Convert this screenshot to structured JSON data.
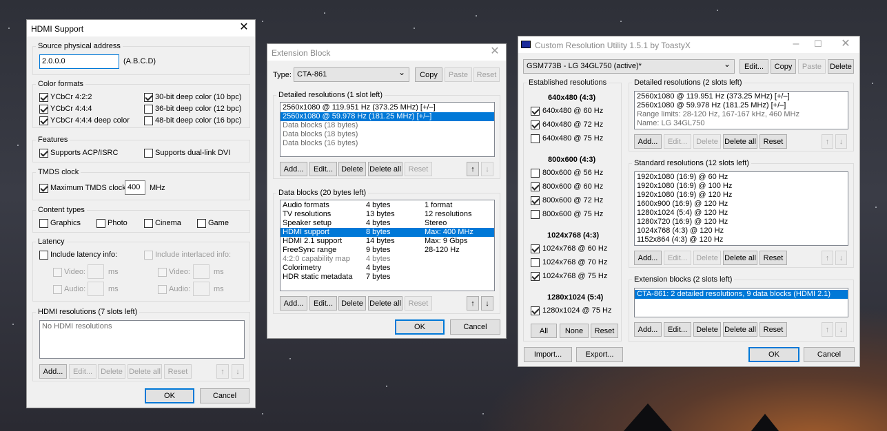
{
  "hdmi": {
    "title": "HDMI Support",
    "source_group": "Source physical address",
    "address": "2.0.0.0",
    "address_hint": "(A.B.C.D)",
    "color_group": "Color formats",
    "ycbcr422": "YCbCr 4:2:2",
    "ycbcr444": "YCbCr 4:4:4",
    "ycbcr444deep": "YCbCr 4:4:4 deep color",
    "deep30": "30-bit deep color (10 bpc)",
    "deep36": "36-bit deep color (12 bpc)",
    "deep48": "48-bit deep color (16 bpc)",
    "features_group": "Features",
    "acp": "Supports ACP/ISRC",
    "dual_dvi": "Supports dual-link DVI",
    "tmds_group": "TMDS clock",
    "tmds_label": "Maximum TMDS clock:",
    "tmds_value": "400",
    "tmds_unit": "MHz",
    "content_group": "Content types",
    "graphics": "Graphics",
    "photo": "Photo",
    "cinema": "Cinema",
    "game": "Game",
    "latency_group": "Latency",
    "include_latency": "Include latency info:",
    "include_interlaced": "Include interlaced info:",
    "video": "Video:",
    "audio": "Audio:",
    "ms": "ms",
    "res_group": "HDMI resolutions (7 slots left)",
    "res_empty": "No HDMI resolutions",
    "add": "Add...",
    "edit": "Edit...",
    "delete": "Delete",
    "delete_all": "Delete all",
    "reset": "Reset",
    "up": "↑",
    "down": "↓",
    "ok": "OK",
    "cancel": "Cancel"
  },
  "ext": {
    "title": "Extension Block",
    "type_label": "Type:",
    "type_value": "CTA-861",
    "copy": "Copy",
    "paste": "Paste",
    "reset": "Reset",
    "detailed_group": "Detailed resolutions (1 slot left)",
    "detailed": [
      {
        "text": "2560x1080 @ 119.951 Hz (373.25 MHz) [+/–]",
        "state": "normal"
      },
      {
        "text": "2560x1080 @ 59.978 Hz (181.25 MHz) [+/–]",
        "state": "sel"
      },
      {
        "text": "Data blocks (18 bytes)",
        "state": "gray"
      },
      {
        "text": "Data blocks (18 bytes)",
        "state": "gray"
      },
      {
        "text": "Data blocks (16 bytes)",
        "state": "gray"
      }
    ],
    "data_group": "Data blocks (20 bytes left)",
    "data_blocks": [
      {
        "name": "Audio formats",
        "size": "4 bytes",
        "info": "1 format",
        "state": "normal"
      },
      {
        "name": "TV resolutions",
        "size": "13 bytes",
        "info": "12 resolutions",
        "state": "normal"
      },
      {
        "name": "Speaker setup",
        "size": "4 bytes",
        "info": "Stereo",
        "state": "normal"
      },
      {
        "name": "HDMI support",
        "size": "8 bytes",
        "info": "Max: 400 MHz",
        "state": "sel"
      },
      {
        "name": "HDMI 2.1 support",
        "size": "14 bytes",
        "info": "Max: 9 Gbps",
        "state": "normal"
      },
      {
        "name": "FreeSync range",
        "size": "9 bytes",
        "info": "28-120 Hz",
        "state": "normal"
      },
      {
        "name": "4:2:0 capability map",
        "size": "4 bytes",
        "info": "",
        "state": "dis"
      },
      {
        "name": "Colorimetry",
        "size": "4 bytes",
        "info": "",
        "state": "normal"
      },
      {
        "name": "HDR static metadata",
        "size": "7 bytes",
        "info": "",
        "state": "normal"
      }
    ],
    "add": "Add...",
    "edit": "Edit...",
    "delete": "Delete",
    "delete_all": "Delete all",
    "reset_btn": "Reset",
    "up": "↑",
    "down": "↓",
    "ok": "OK",
    "cancel": "Cancel"
  },
  "cru": {
    "title": "Custom Resolution Utility 1.5.1 by ToastyX",
    "monitor": "GSM773B - LG 34GL750 (active)*",
    "edit": "Edit...",
    "copy": "Copy",
    "paste": "Paste",
    "delete": "Delete",
    "established_group": "Established resolutions",
    "h640": "640x480 (4:3)",
    "r640_60": "640x480 @ 60 Hz",
    "r640_72": "640x480 @ 72 Hz",
    "r640_75": "640x480 @ 75 Hz",
    "h800": "800x600 (4:3)",
    "r800_56": "800x600 @ 56 Hz",
    "r800_60": "800x600 @ 60 Hz",
    "r800_72": "800x600 @ 72 Hz",
    "r800_75": "800x600 @ 75 Hz",
    "h1024": "1024x768 (4:3)",
    "r1024_60": "1024x768 @ 60 Hz",
    "r1024_70": "1024x768 @ 70 Hz",
    "r1024_75": "1024x768 @ 75 Hz",
    "h1280": "1280x1024 (5:4)",
    "r1280_75": "1280x1024 @ 75 Hz",
    "all": "All",
    "none": "None",
    "reset": "Reset",
    "detailed_group": "Detailed resolutions (2 slots left)",
    "detailed": [
      {
        "text": "2560x1080 @ 119.951 Hz (373.25 MHz) [+/–]",
        "state": "normal"
      },
      {
        "text": "2560x1080 @ 59.978 Hz (181.25 MHz) [+/–]",
        "state": "normal"
      },
      {
        "text": "Range limits: 28-120 Hz, 167-167 kHz, 460 MHz",
        "state": "gray"
      },
      {
        "text": "Name: LG 34GL750",
        "state": "gray"
      }
    ],
    "standard_group": "Standard resolutions (12 slots left)",
    "standard": [
      "1920x1080 (16:9) @ 60 Hz",
      "1920x1080 (16:9) @ 100 Hz",
      "1920x1080 (16:9) @ 120 Hz",
      "1600x900 (16:9) @ 120 Hz",
      "1280x1024 (5:4) @ 120 Hz",
      "1280x720 (16:9) @ 120 Hz",
      "1024x768 (4:3) @ 120 Hz",
      "1152x864 (4:3) @ 120 Hz"
    ],
    "ext_group": "Extension blocks (2 slots left)",
    "extensions": [
      "CTA-861: 2 detailed resolutions, 9 data blocks (HDMI 2.1)"
    ],
    "add": "Add...",
    "edit_btn": "Edit...",
    "delete_btn": "Delete",
    "delete_all": "Delete all",
    "reset_btn": "Reset",
    "up": "↑",
    "down": "↓",
    "import": "Import...",
    "export": "Export...",
    "ok": "OK",
    "cancel": "Cancel"
  }
}
